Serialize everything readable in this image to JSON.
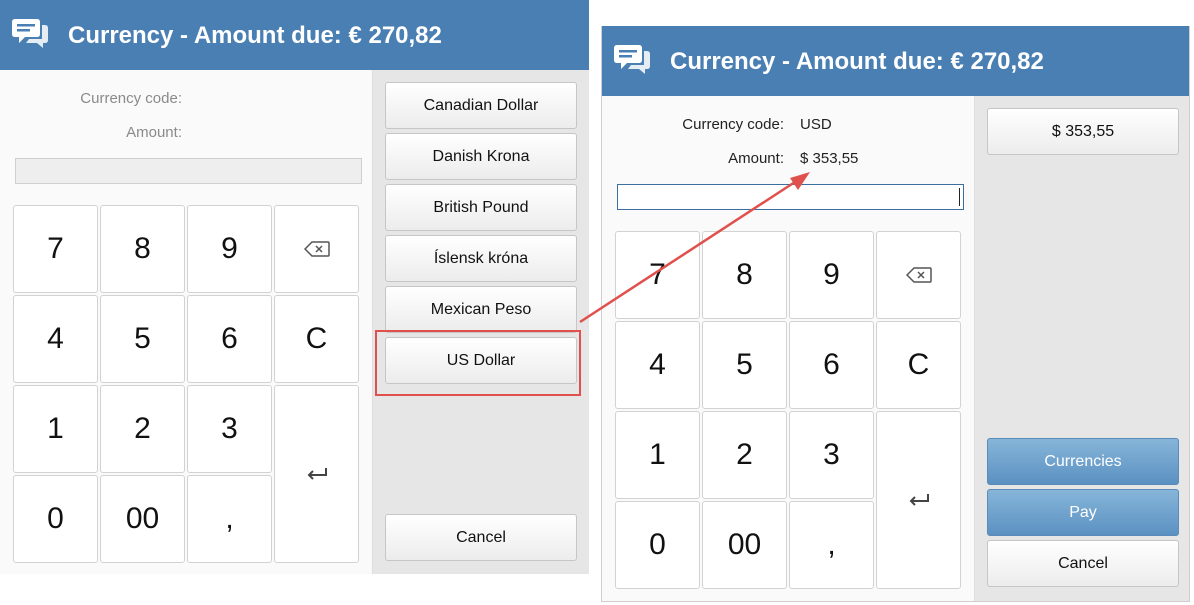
{
  "left": {
    "title": "Currency - Amount due: € 270,82",
    "currency_code_label": "Currency code:",
    "amount_label": "Amount:",
    "keypad": [
      "7",
      "8",
      "9",
      "4",
      "5",
      "6",
      "C",
      "1",
      "2",
      "3",
      "0",
      "00",
      ","
    ],
    "currencies": [
      "Canadian Dollar",
      "Danish Krona",
      "British Pound",
      "Íslensk króna",
      "Mexican Peso",
      "US Dollar"
    ],
    "cancel": "Cancel"
  },
  "right": {
    "title": "Currency - Amount due: € 270,82",
    "currency_code_label": "Currency code:",
    "currency_code_value": "USD",
    "amount_label": "Amount:",
    "amount_value": "$ 353,55",
    "keypad": [
      "7",
      "8",
      "9",
      "4",
      "5",
      "6",
      "C",
      "1",
      "2",
      "3",
      "0",
      "00",
      ","
    ],
    "quick_amount": "$ 353,55",
    "currencies": "Currencies",
    "pay": "Pay",
    "cancel": "Cancel"
  },
  "icons": {
    "header": "chat-icon",
    "backspace": "backspace-icon",
    "enter": "enter-icon"
  },
  "colors": {
    "header_bg": "#4a7fb3",
    "highlight": "#e0514d",
    "blue_button": "#6a9ecb"
  }
}
